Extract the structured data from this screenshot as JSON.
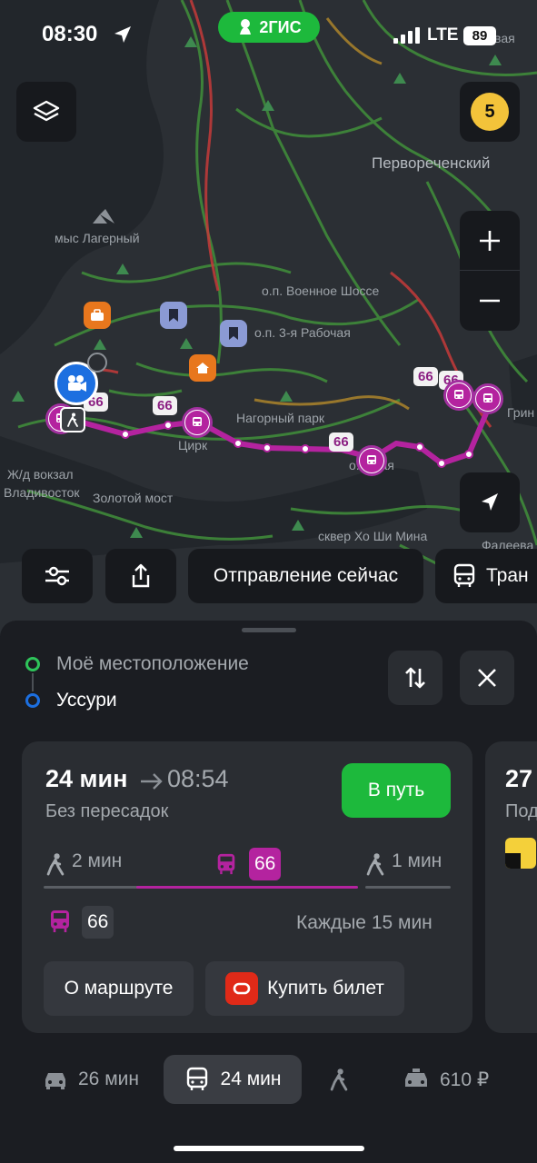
{
  "status_bar": {
    "time": "08:30",
    "brand": "2ГИС",
    "network": "LTE",
    "battery": "89"
  },
  "map": {
    "notifications_badge": "5",
    "labels": {
      "pervorechensky": "Первореченский",
      "mys_lagerny": "мыс Лагерный",
      "voennoe_shosse": "о.п. Военное Шоссе",
      "rabochaya": "о.п. 3-я Рабочая",
      "nagorny_park": "Нагорный парк",
      "tsirk": "Цирк",
      "zhd_vokzal": "Ж/д вокзал",
      "vladivostok": "Владивосток",
      "zolotoy_most": "Золотой мост",
      "skver": "сквер Хо Ши Мина",
      "ovaya": "овая",
      "ovaya2": "о...овая",
      "grin": "Грин",
      "faleeva": "Фалеева",
      "tovaya": "товая"
    },
    "route_chips": [
      "66",
      "66",
      "66",
      "66",
      "66"
    ],
    "colors": {
      "route": "#b4239f",
      "traffic_green": "#3a9b3a",
      "traffic_red": "#c53a3a",
      "water": "#22262b"
    }
  },
  "controls": {
    "departure_label": "Отправление сейчас",
    "transport_label": "Тран"
  },
  "sheet": {
    "from_label": "Моё местоположение",
    "to_label": "Уссури",
    "route_card": {
      "duration": "24 мин",
      "arrival_time": "08:54",
      "transfers": "Без пересадок",
      "go_label": "В путь",
      "walk_start": "2 мин",
      "bus_number": "66",
      "walk_end": "1 мин",
      "schedule_bus": "66",
      "frequency": "Каждые 15 мин",
      "about_label": "О маршруте",
      "buy_ticket_label": "Купить билет",
      "colors": {
        "go": "#1db93c",
        "bus": "#b4239f",
        "ticket_logo": "#e02a18"
      }
    },
    "peek_card": {
      "duration": "27",
      "sub": "Под"
    },
    "modes": {
      "car": "26 мин",
      "transit": "24 мин",
      "taxi": "610 ₽"
    }
  }
}
